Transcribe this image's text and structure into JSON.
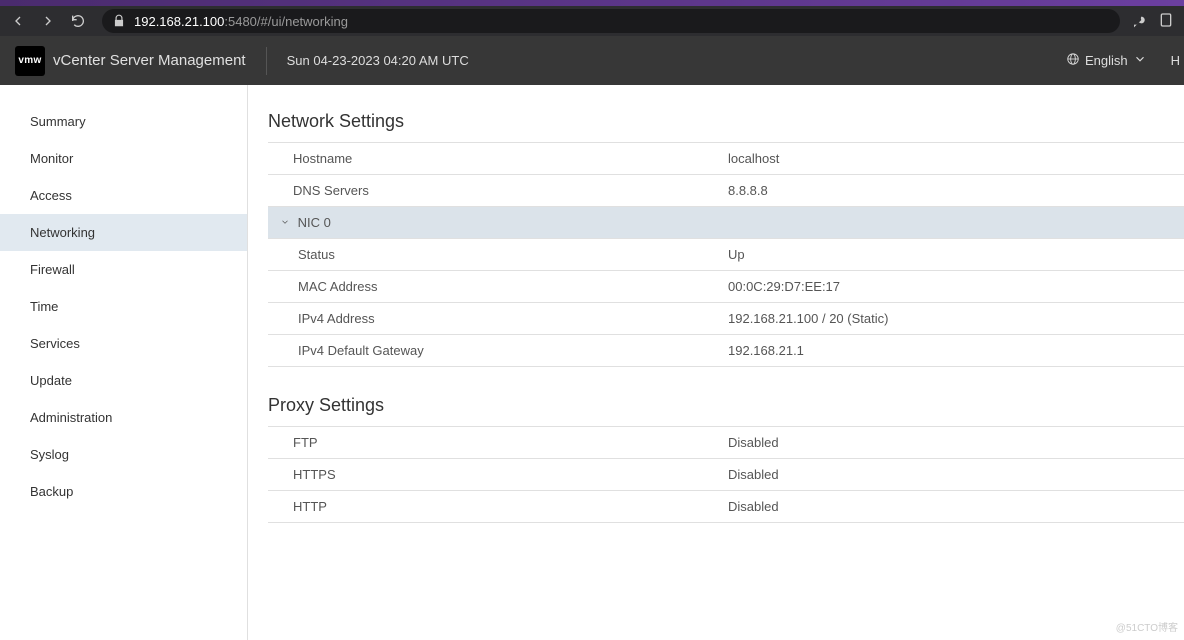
{
  "browser": {
    "url_host": "192.168.21.100",
    "url_path": ":5480/#/ui/networking"
  },
  "header": {
    "app_title": "vCenter Server Management",
    "datetime": "Sun 04-23-2023 04:20 AM UTC",
    "language": "English",
    "help": "H"
  },
  "sidebar": {
    "summary": "Summary",
    "monitor": "Monitor",
    "access": "Access",
    "networking": "Networking",
    "firewall": "Firewall",
    "time": "Time",
    "services": "Services",
    "update": "Update",
    "administration": "Administration",
    "syslog": "Syslog",
    "backup": "Backup"
  },
  "network": {
    "title": "Network Settings",
    "hostname_label": "Hostname",
    "hostname_value": "localhost",
    "dns_label": "DNS Servers",
    "dns_value": "8.8.8.8",
    "nic_label": "NIC 0",
    "status_label": "Status",
    "status_value": "Up",
    "mac_label": "MAC Address",
    "mac_value": "00:0C:29:D7:EE:17",
    "ipv4addr_label": "IPv4 Address",
    "ipv4addr_value": "192.168.21.100 / 20 (Static)",
    "ipv4gw_label": "IPv4 Default Gateway",
    "ipv4gw_value": "192.168.21.1"
  },
  "proxy": {
    "title": "Proxy Settings",
    "ftp_label": "FTP",
    "ftp_value": "Disabled",
    "https_label": "HTTPS",
    "https_value": "Disabled",
    "http_label": "HTTP",
    "http_value": "Disabled"
  },
  "watermark": "@51CTO博客"
}
